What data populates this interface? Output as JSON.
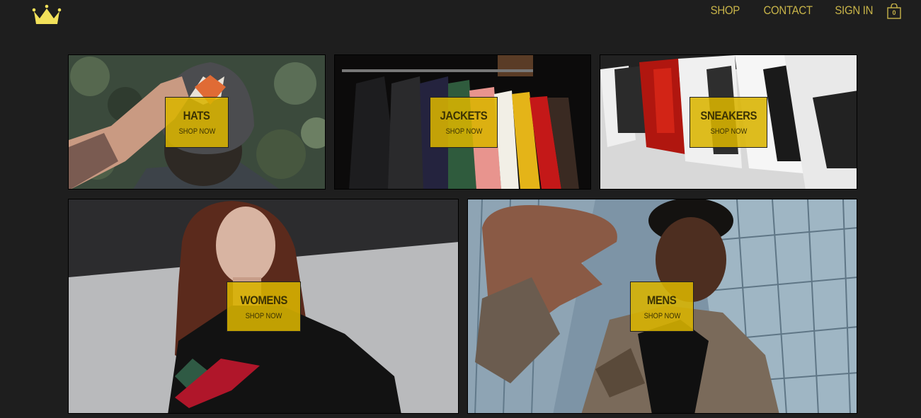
{
  "header": {
    "logo": "crown-icon",
    "nav": [
      {
        "label": "SHOP"
      },
      {
        "label": "CONTACT"
      },
      {
        "label": "SIGN IN"
      }
    ],
    "cart_count": "0",
    "accent_color": "#c8b449"
  },
  "categories": [
    {
      "title": "HATS",
      "subtitle": "SHOP NOW"
    },
    {
      "title": "JACKETS",
      "subtitle": "SHOP NOW"
    },
    {
      "title": "SNEAKERS",
      "subtitle": "SHOP NOW"
    },
    {
      "title": "WOMENS",
      "subtitle": "SHOP NOW"
    },
    {
      "title": "MENS",
      "subtitle": "SHOP NOW"
    }
  ],
  "badge_color": "#d9b400"
}
